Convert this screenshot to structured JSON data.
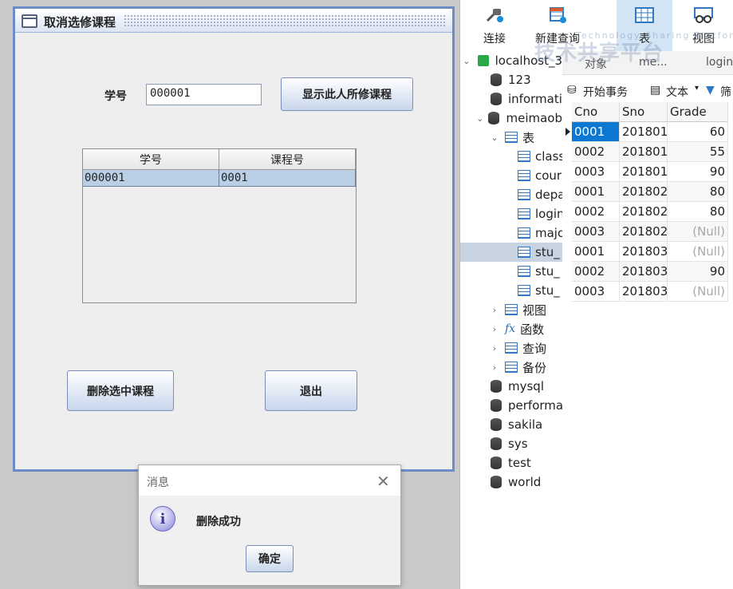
{
  "swing_window": {
    "title": "取消选修课程",
    "student_id_label": "学号",
    "student_id_value": "000001",
    "show_courses_button": "显示此人所修课程",
    "table": {
      "columns": [
        "学号",
        "课程号"
      ],
      "rows": [
        [
          "000001",
          "0001"
        ]
      ]
    },
    "delete_button": "删除选中课程",
    "exit_button": "退出"
  },
  "message_dialog": {
    "title": "消息",
    "close_glyph": "✕",
    "icon_glyph": "i",
    "message": "删除成功",
    "ok_button": "确定"
  },
  "navicat": {
    "toolbar": [
      {
        "label": "连接",
        "icon": "connect-icon"
      },
      {
        "label": "新建查询",
        "icon": "new-query-icon"
      },
      {
        "label": "表",
        "icon": "table-icon",
        "active": true
      },
      {
        "label": "视图",
        "icon": "view-icon"
      }
    ],
    "tree": {
      "connection": "localhost_3",
      "items": [
        {
          "label": "123",
          "type": "db"
        },
        {
          "label": "informati",
          "type": "db"
        },
        {
          "label": "meimaob",
          "type": "db-open"
        },
        {
          "label": "表",
          "type": "folder-open"
        },
        {
          "label": "class",
          "type": "table"
        },
        {
          "label": "cour",
          "type": "table"
        },
        {
          "label": "depa",
          "type": "table"
        },
        {
          "label": "login",
          "type": "table"
        },
        {
          "label": "majo",
          "type": "table"
        },
        {
          "label": "stu_",
          "type": "table",
          "selected": true
        },
        {
          "label": "stu_",
          "type": "table"
        },
        {
          "label": "stu_",
          "type": "table"
        },
        {
          "label": "视图",
          "type": "group"
        },
        {
          "label": "函数",
          "type": "group-fx"
        },
        {
          "label": "查询",
          "type": "group"
        },
        {
          "label": "备份",
          "type": "group"
        },
        {
          "label": "mysql",
          "type": "db"
        },
        {
          "label": "performa",
          "type": "db"
        },
        {
          "label": "sakila",
          "type": "db"
        },
        {
          "label": "sys",
          "type": "db"
        },
        {
          "label": "test",
          "type": "db"
        },
        {
          "label": "world",
          "type": "db"
        }
      ]
    },
    "tabs": [
      "对象",
      "me...",
      "login"
    ],
    "table_toolbar": {
      "transaction": "开始事务",
      "text": "文本",
      "filter": "筛"
    },
    "grid": {
      "columns": [
        "Cno",
        "Sno",
        "Grade"
      ],
      "rows": [
        [
          "0001",
          "201801",
          "60"
        ],
        [
          "0002",
          "201801",
          "55"
        ],
        [
          "0003",
          "201801",
          "90"
        ],
        [
          "0001",
          "201802",
          "80"
        ],
        [
          "0002",
          "201802",
          "80"
        ],
        [
          "0003",
          "201802",
          "(Null)"
        ],
        [
          "0001",
          "201803",
          "(Null)"
        ],
        [
          "0002",
          "201803",
          "90"
        ],
        [
          "0003",
          "201803",
          "(Null)"
        ]
      ]
    }
  },
  "watermark": {
    "text": "技术共享平台",
    "subtext": "Technology Sharing Platform"
  }
}
